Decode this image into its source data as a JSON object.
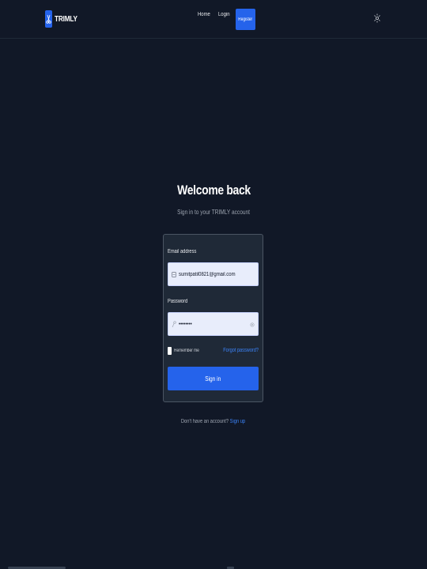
{
  "header": {
    "brand": "TRIMLY",
    "nav": {
      "home": "Home",
      "login": "Login",
      "register": "Register"
    }
  },
  "main": {
    "title": "Welcome back",
    "subtitle": "Sign in to your TRIMLY account"
  },
  "form": {
    "email_label": "Email address",
    "email_value": "sumitpatil0821@gmail.com",
    "password_label": "Password",
    "password_value": "••••••••",
    "remember_label": "Remember me",
    "forgot_link": "Forgot password?",
    "submit_label": "Sign in"
  },
  "footer": {
    "prompt": "Don't have an account?",
    "signup_link": "Sign up"
  },
  "icons": {
    "logo": "scissors-icon",
    "theme": "sun-icon",
    "email": "mail-icon",
    "password": "key-icon",
    "reveal": "eye-icon"
  },
  "colors": {
    "background": "#111827",
    "card": "#1f2937",
    "accent": "#2563eb",
    "link": "#3b82f6",
    "input": "#e8edfb"
  }
}
